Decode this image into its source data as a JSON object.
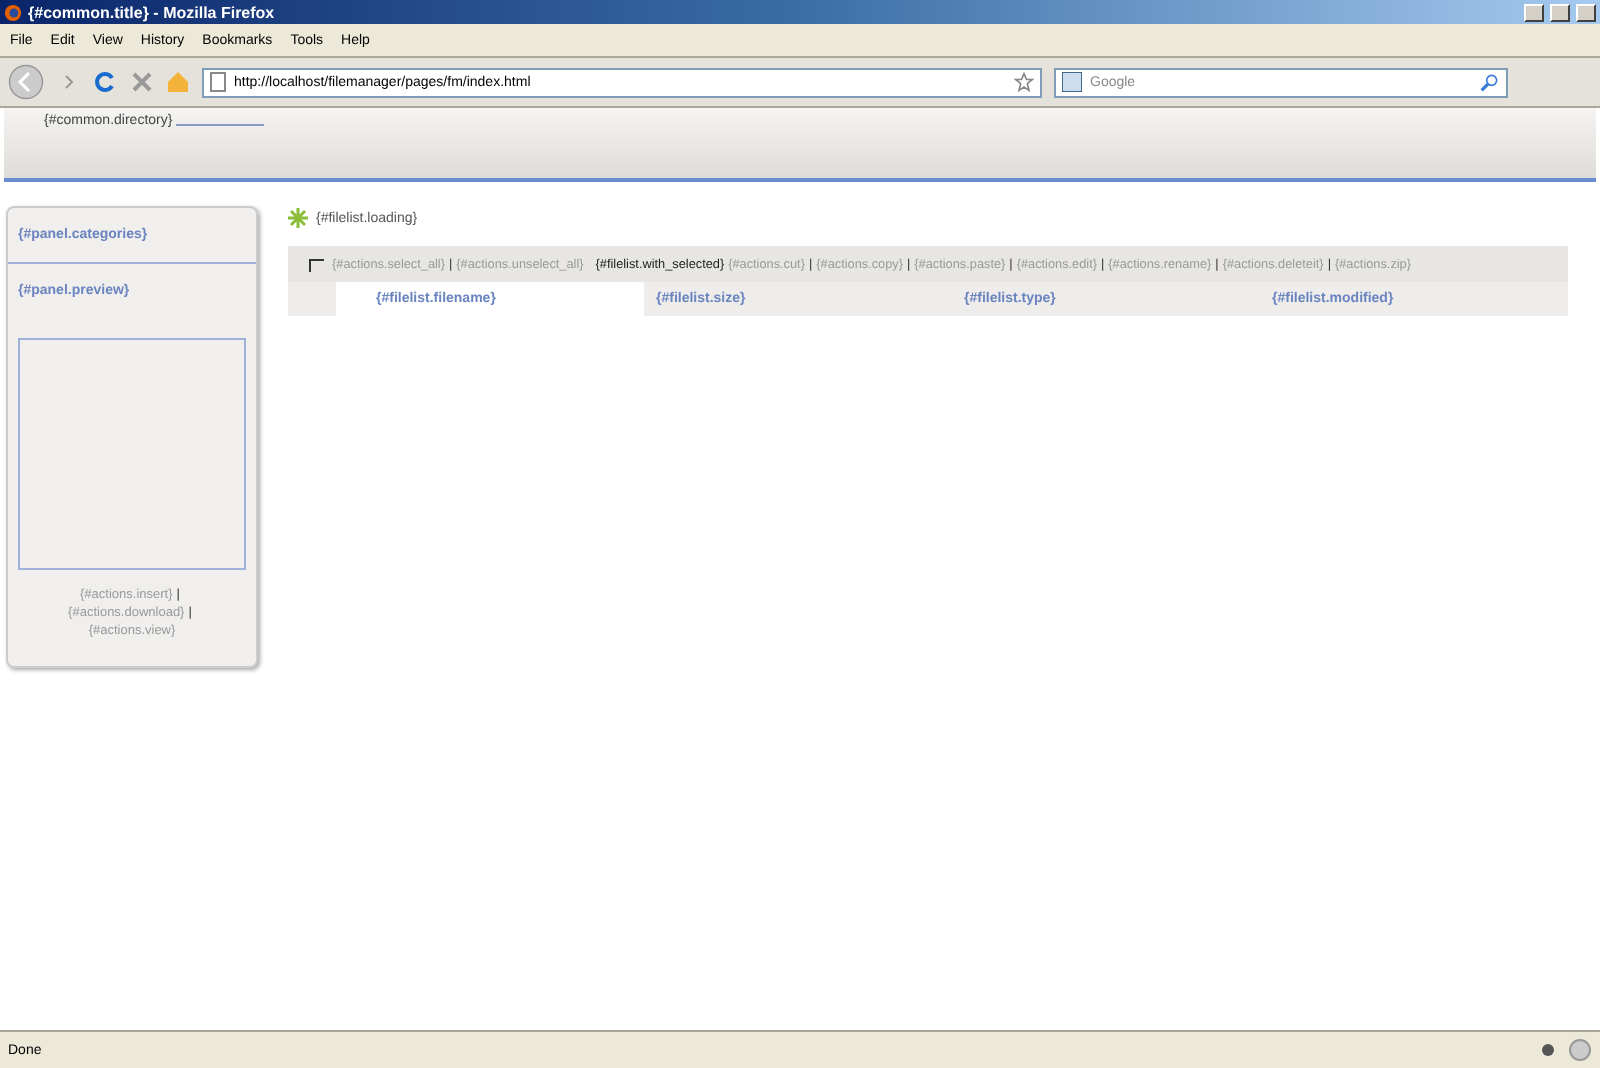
{
  "window": {
    "title": "{#common.title} - Mozilla Firefox"
  },
  "menu": [
    "File",
    "Edit",
    "View",
    "History",
    "Bookmarks",
    "Tools",
    "Help"
  ],
  "address": {
    "value": "http://localhost/filemanager/pages/fm/index.html"
  },
  "search": {
    "placeholder": "Google"
  },
  "header": {
    "directory": "{#common.directory}"
  },
  "sidebar": {
    "categories": "{#panel.categories}",
    "preview": "{#panel.preview}",
    "separator": "|",
    "actions": [
      "{#actions.insert}",
      "{#actions.download}",
      "{#actions.view}"
    ]
  },
  "filelist": {
    "loading": "{#filelist.loading}",
    "separator": "|",
    "select_actions": [
      "{#actions.select_all}",
      "{#actions.unselect_all}"
    ],
    "with_selected": "{#filelist.with_selected}",
    "actions": [
      "{#actions.cut}",
      "{#actions.copy}",
      "{#actions.paste}",
      "{#actions.edit}",
      "{#actions.rename}",
      "{#actions.deleteit}",
      "{#actions.zip}"
    ],
    "columns": [
      "{#filelist.filename}",
      "{#filelist.size}",
      "{#filelist.type}",
      "{#filelist.modified}"
    ]
  },
  "status_bar": {
    "text": "Done"
  }
}
